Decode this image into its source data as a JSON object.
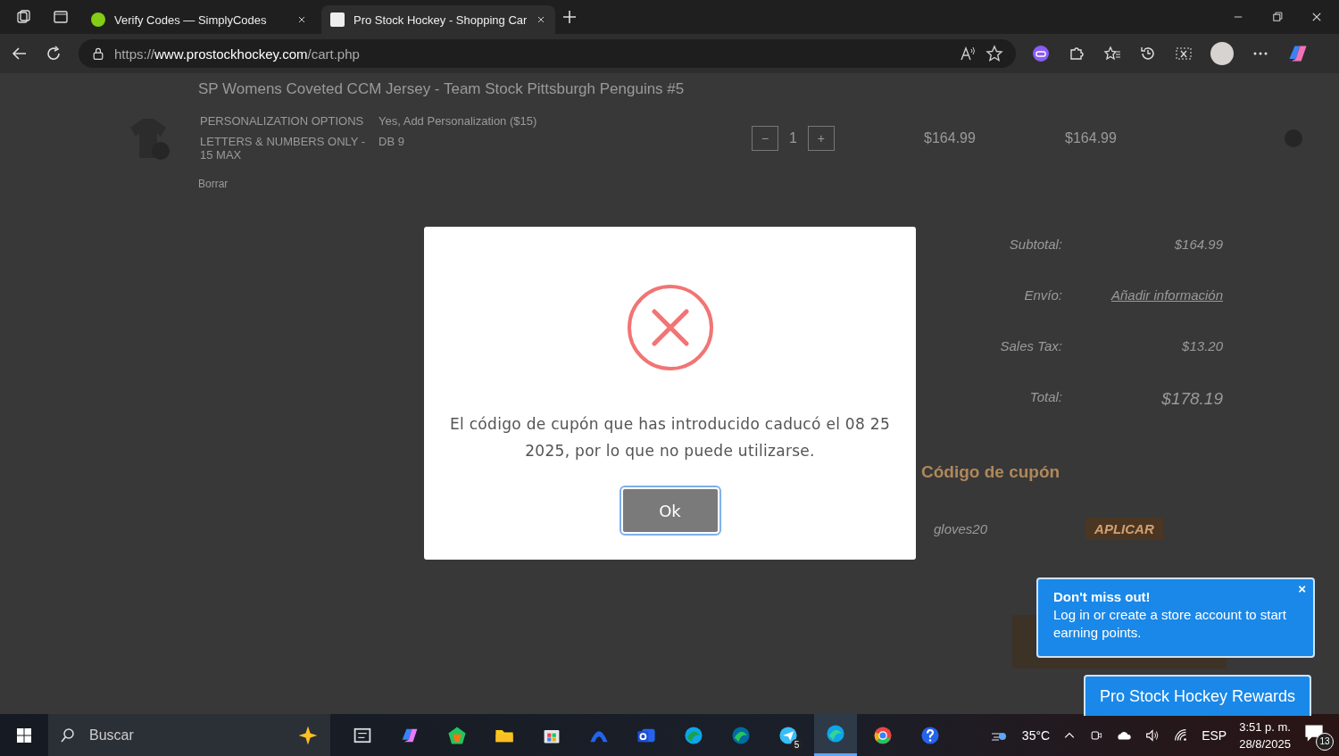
{
  "browser": {
    "tabs": [
      {
        "title": "Verify Codes — SimplyCodes",
        "selected": false
      },
      {
        "title": "Pro Stock Hockey - Shopping Car",
        "selected": true
      }
    ],
    "url_scheme": "https://",
    "url_host": "www.prostockhockey.com",
    "url_path": "/cart.php"
  },
  "cart": {
    "product_title": "SP Womens Coveted CCM Jersey - Team Stock Pittsburgh Penguins #5",
    "options": [
      {
        "label": "PERSONALIZATION OPTIONS",
        "value": "Yes, Add Personalization ($15)"
      },
      {
        "label": "LETTERS & NUMBERS ONLY - 15 MAX",
        "value": "DB 9"
      }
    ],
    "remove": "Borrar",
    "decrease": "−",
    "increase": "+",
    "quantity": "1",
    "price": "$164.99",
    "line_total": "$164.99"
  },
  "summary": [
    {
      "label": "Subtotal:",
      "value": "$164.99",
      "kind": "text"
    },
    {
      "label": "Envío:",
      "value": "Añadir información",
      "kind": "link"
    },
    {
      "label": "Sales Tax:",
      "value": "$13.20",
      "kind": "text"
    },
    {
      "label": "Total:",
      "value": "$178.19",
      "kind": "total"
    }
  ],
  "coupon": {
    "heading": "Código de cupón",
    "value": "gloves20",
    "button": "APLICAR"
  },
  "modal": {
    "message": "El código de cupón que has introducido caducó el 08 25 2025, por lo que no puede utilizarse.",
    "button": "Ok"
  },
  "toast": {
    "title": "Don't miss out!",
    "body": "Log in or create a store account to start earning points.",
    "close": "×"
  },
  "rewards_button": "Pro Stock Hockey Rewards",
  "taskbar": {
    "search_placeholder": "Buscar",
    "temperature": "35°C",
    "language": "ESP",
    "time": "3:51 p. m.",
    "date": "28/8/2025",
    "notifications": "13",
    "apps": [
      {
        "kind": "taskview",
        "selected": false
      },
      {
        "kind": "copilot",
        "selected": false
      },
      {
        "kind": "paint",
        "selected": false
      },
      {
        "kind": "folder",
        "selected": false
      },
      {
        "kind": "store",
        "selected": false
      },
      {
        "kind": "arc",
        "selected": false
      },
      {
        "kind": "mail",
        "selected": false
      },
      {
        "kind": "edge-beta",
        "selected": false
      },
      {
        "kind": "edge-dev",
        "selected": false
      },
      {
        "kind": "telegram",
        "selected": false,
        "badge": "5"
      },
      {
        "kind": "edge",
        "selected": true
      },
      {
        "kind": "chrome",
        "selected": false
      },
      {
        "kind": "help",
        "selected": false
      }
    ]
  }
}
